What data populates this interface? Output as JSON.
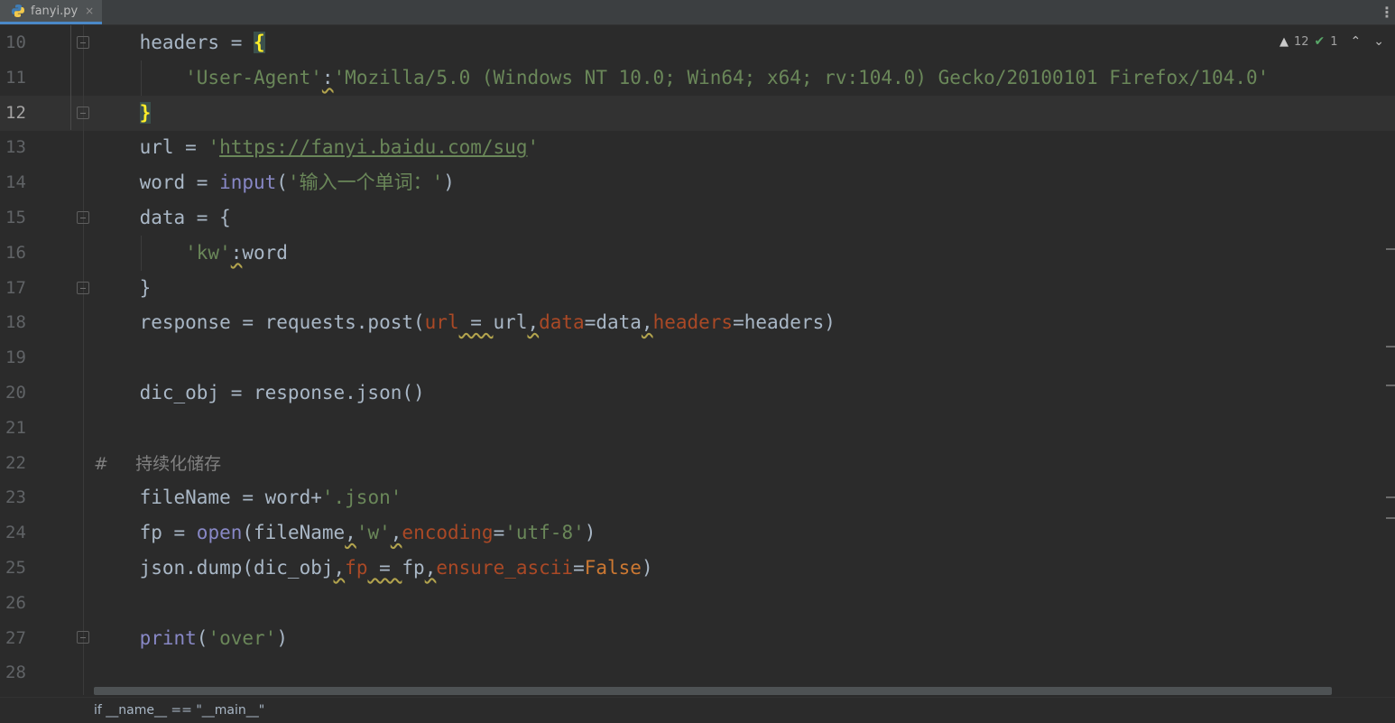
{
  "tab": {
    "filename": "fanyi.py",
    "close_glyph": "×",
    "menu_glyph": "⋮",
    "icon": "python-file-icon"
  },
  "inspections": {
    "warnings": "12",
    "ok": "1",
    "warn_glyph": "▲",
    "ok_glyph": "✔",
    "prev_glyph": "⌃",
    "next_glyph": "⌄"
  },
  "lines": [
    {
      "n": "10",
      "segments": [
        [
          "",
          "    headers = "
        ],
        [
          "brace-hl",
          "{"
        ]
      ]
    },
    {
      "n": "11",
      "segments": [
        [
          "str",
          "        'User-Agent'"
        ],
        [
          "wavy",
          ":"
        ],
        [
          "str",
          "'Mozilla/5.0 (Windows NT 10.0; Win64; x64; rv:104.0) Gecko/20100101 Firefox/104.0'"
        ]
      ]
    },
    {
      "n": "12",
      "segments": [
        [
          "",
          "    "
        ],
        [
          "brace-hl",
          "}"
        ]
      ]
    },
    {
      "n": "13",
      "segments": [
        [
          "",
          "    url = "
        ],
        [
          "str",
          "'"
        ],
        [
          "link",
          "https://fanyi.baidu.com/sug"
        ],
        [
          "str",
          "'"
        ]
      ]
    },
    {
      "n": "14",
      "segments": [
        [
          "",
          "    word = "
        ],
        [
          "bi",
          "input"
        ],
        [
          "",
          "("
        ],
        [
          "str",
          "'输入一个单词：'"
        ],
        [
          "",
          ")"
        ]
      ]
    },
    {
      "n": "15",
      "segments": [
        [
          "",
          "    data = {"
        ]
      ]
    },
    {
      "n": "16",
      "segments": [
        [
          "str",
          "        'kw'"
        ],
        [
          "wavy",
          ":"
        ],
        [
          "",
          "word"
        ]
      ]
    },
    {
      "n": "17",
      "segments": [
        [
          "",
          "    }"
        ]
      ]
    },
    {
      "n": "18",
      "segments": [
        [
          "",
          "    response = requests.post("
        ],
        [
          "param",
          "url"
        ],
        [
          "wavy",
          " = "
        ],
        [
          "",
          "url"
        ],
        [
          "wavy",
          ","
        ],
        [
          "param",
          "data"
        ],
        [
          "",
          "=data"
        ],
        [
          "wavy",
          ","
        ],
        [
          "param",
          "headers"
        ],
        [
          "",
          "=headers)"
        ]
      ]
    },
    {
      "n": "19",
      "segments": []
    },
    {
      "n": "20",
      "segments": [
        [
          "",
          "    dic_obj = response.json()"
        ]
      ]
    },
    {
      "n": "21",
      "segments": []
    },
    {
      "n": "22",
      "segments": [
        [
          "cmt",
          "#     持续化储存"
        ]
      ]
    },
    {
      "n": "23",
      "segments": [
        [
          "",
          "    fileName = word+"
        ],
        [
          "str",
          "'.json'"
        ]
      ]
    },
    {
      "n": "24",
      "segments": [
        [
          "",
          "    fp = "
        ],
        [
          "bi",
          "open"
        ],
        [
          "",
          "(fileName"
        ],
        [
          "wavy",
          ","
        ],
        [
          "str",
          "'w'"
        ],
        [
          "wavy",
          ","
        ],
        [
          "param",
          "encoding"
        ],
        [
          "",
          "="
        ],
        [
          "str",
          "'utf-8'"
        ],
        [
          "",
          ")"
        ]
      ]
    },
    {
      "n": "25",
      "segments": [
        [
          "",
          "    json.dump(dic_obj"
        ],
        [
          "wavy",
          ","
        ],
        [
          "param",
          "fp"
        ],
        [
          "wavy",
          " = "
        ],
        [
          "",
          "fp"
        ],
        [
          "wavy",
          ","
        ],
        [
          "param",
          "ensure_ascii"
        ],
        [
          "",
          "="
        ],
        [
          "kw",
          "False"
        ],
        [
          "",
          ")"
        ]
      ]
    },
    {
      "n": "26",
      "segments": []
    },
    {
      "n": "27",
      "segments": [
        [
          "",
          "    "
        ],
        [
          "bi",
          "print"
        ],
        [
          "",
          "("
        ],
        [
          "str",
          "'over'"
        ],
        [
          "",
          ")"
        ]
      ]
    },
    {
      "n": "28",
      "segments": []
    }
  ],
  "breadcrumb": "if __name__ == \"__main__\""
}
